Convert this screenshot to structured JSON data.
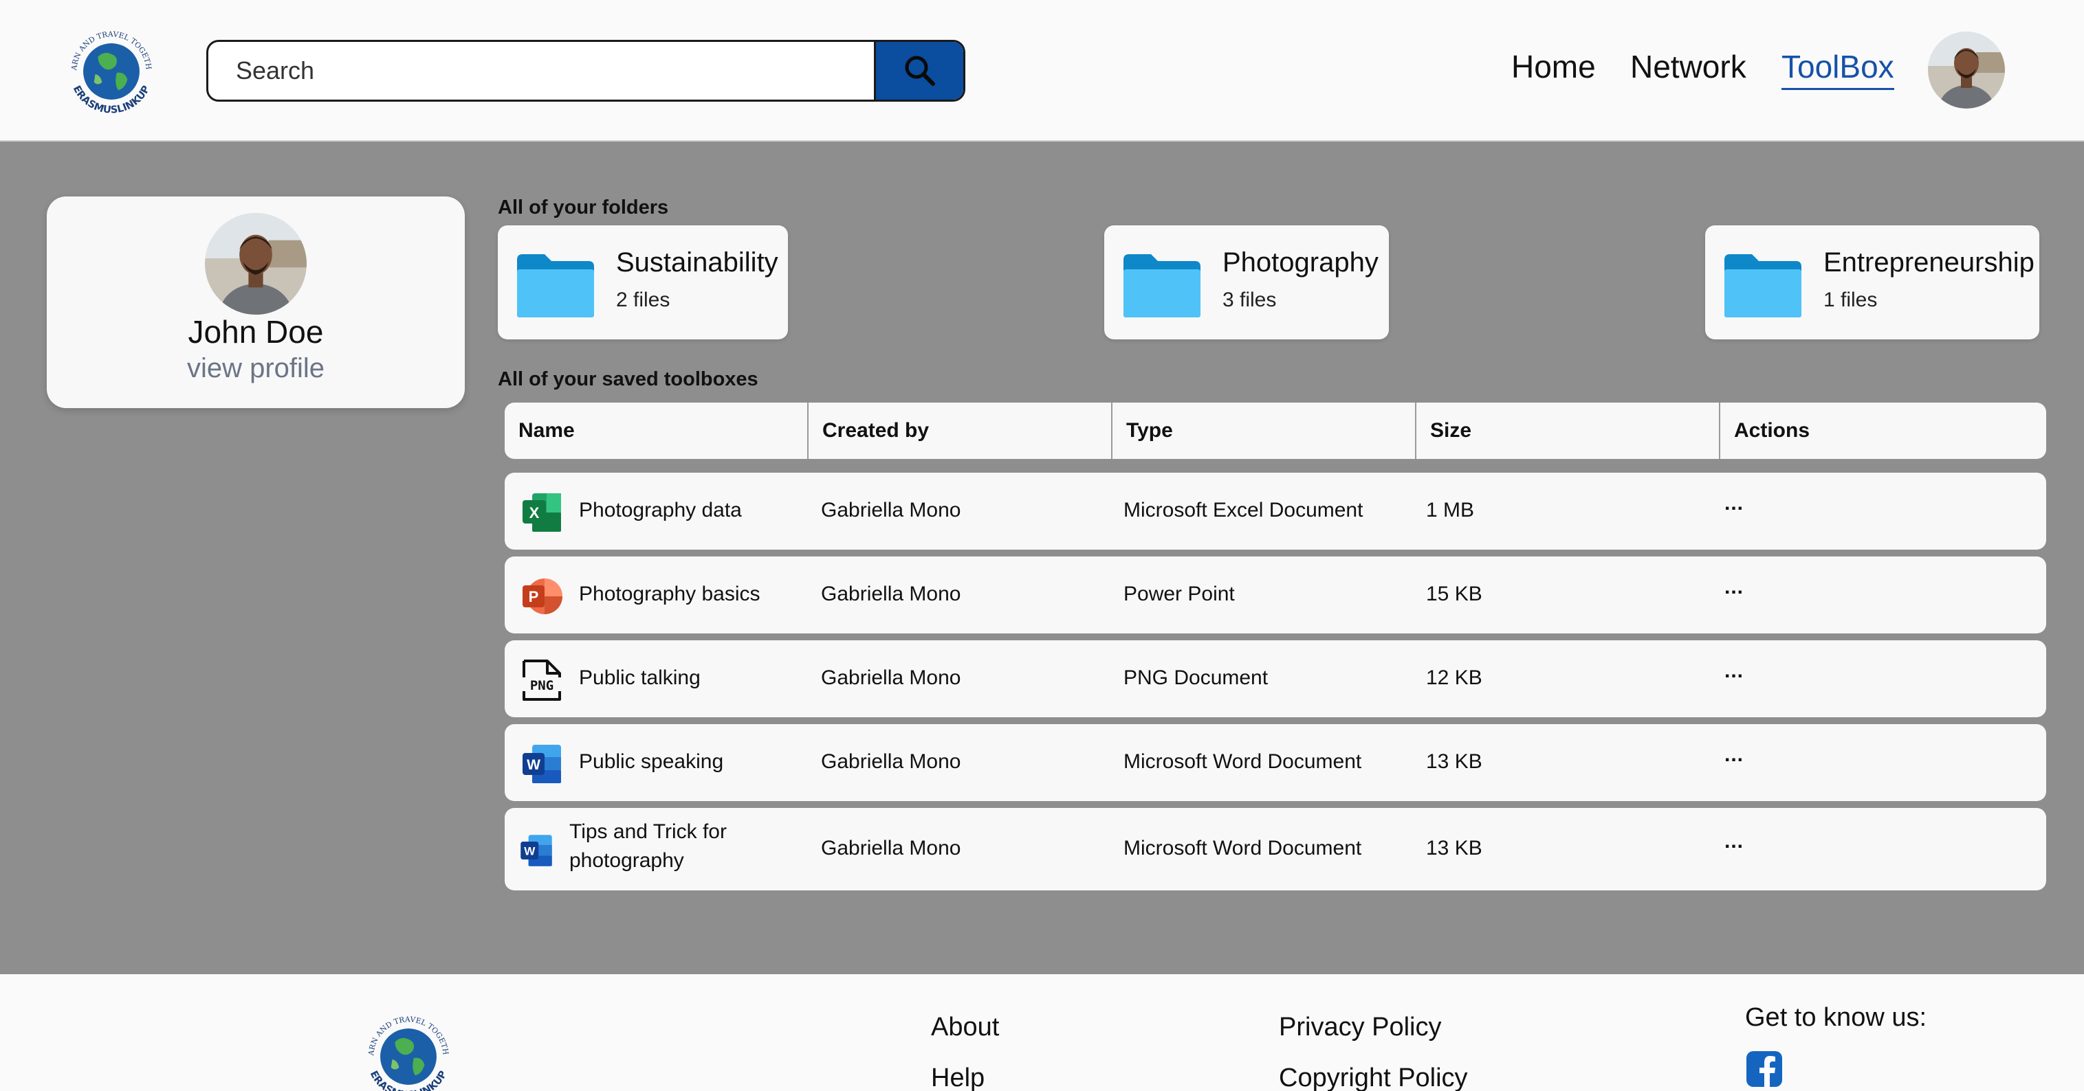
{
  "header": {
    "logo_text_top": "LEARN AND TRAVEL TOGETHER",
    "logo_text_bottom": "ERASMUSLINKUP",
    "search_placeholder": "Search",
    "nav": {
      "home": "Home",
      "network": "Network",
      "toolbox": "ToolBox"
    }
  },
  "profile": {
    "name": "John Doe",
    "link": "view profile"
  },
  "folders": {
    "title": "All of your folders",
    "items": [
      {
        "name": "Sustainability",
        "count": "2 files"
      },
      {
        "name": "Photography",
        "count": "3 files"
      },
      {
        "name": "Entrepreneurship",
        "count": "1 files"
      }
    ]
  },
  "toolboxes": {
    "title": "All of your saved toolboxes",
    "columns": [
      "Name",
      "Created by",
      "Type",
      "Size",
      "Actions"
    ],
    "rows": [
      {
        "icon": "excel-icon",
        "name": "Photography data",
        "name_line2": "",
        "created_by": "Gabriella Mono",
        "type": "Microsoft Excel Document",
        "size": "1 MB",
        "actions": "..."
      },
      {
        "icon": "powerpoint-icon",
        "name": "Photography basics",
        "name_line2": "",
        "created_by": "Gabriella Mono",
        "type": "Power Point",
        "size": "15 KB",
        "actions": "..."
      },
      {
        "icon": "png-file-icon",
        "name": "Public talking",
        "name_line2": "",
        "created_by": "Gabriella Mono",
        "type": "PNG Document",
        "size": "12 KB",
        "actions": "..."
      },
      {
        "icon": "word-icon",
        "name": "Public speaking",
        "name_line2": "",
        "created_by": "Gabriella Mono",
        "type": "Microsoft Word Document",
        "size": "13 KB",
        "actions": "..."
      },
      {
        "icon": "word-icon",
        "name": "Tips and Trick for",
        "name_line2": "photography",
        "created_by": "Gabriella Mono",
        "type": "Microsoft Word Document",
        "size": "13 KB",
        "actions": "..."
      }
    ]
  },
  "footer": {
    "about": "About",
    "help": "Help",
    "privacy": "Privacy Policy",
    "copyright": "Copyright Policy",
    "get_to_know": "Get to know us:",
    "social_icon": "facebook-icon"
  },
  "colors": {
    "accent": "#0b4d9e",
    "nav_active": "#1651a8",
    "page_bg": "#8e8e8e",
    "card_bg": "#f8f8f8",
    "folder_blue": "#4fc3f7"
  }
}
